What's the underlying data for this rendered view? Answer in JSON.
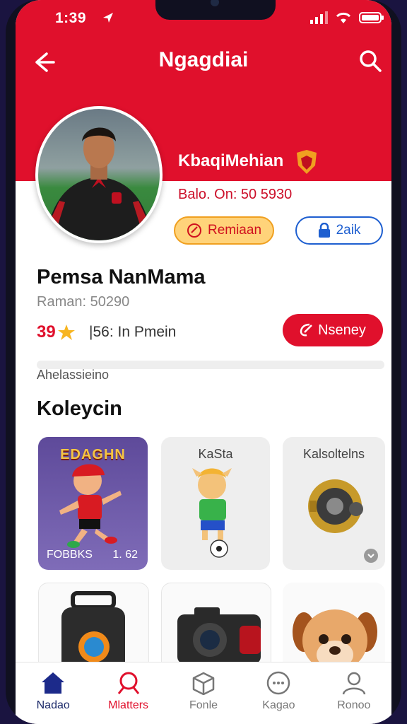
{
  "status_bar": {
    "time": "1:39"
  },
  "header": {
    "title": "Ngagdiai"
  },
  "profile": {
    "club_name": "KbaqiMehian",
    "balance": "Balo. On: 50 5930",
    "reward_button": "Remiaan",
    "lock_button": "2aik",
    "player_name": "Pemsa NanMama",
    "player_sub": "Raman: 50290",
    "score": "39",
    "rank_text": "|56: In Pmein",
    "money_button": "Nseney",
    "progress": 0.0,
    "progress_label": "Ahelassieino"
  },
  "collection": {
    "title": "Koleycin",
    "cards": [
      {
        "title": "EDAGHN",
        "foot_left": "FOBBKS",
        "foot_right": "1. 62"
      },
      {
        "title": "KaSta"
      },
      {
        "title": "Kalsoltelns"
      },
      {
        "title": ""
      },
      {
        "title": ""
      },
      {
        "title": ""
      }
    ]
  },
  "bottom_nav": [
    {
      "label": "Nadao",
      "icon": "home-icon"
    },
    {
      "label": "Mlatters",
      "icon": "whistle-icon"
    },
    {
      "label": "Fonle",
      "icon": "box-icon"
    },
    {
      "label": "Kagao",
      "icon": "chat-icon"
    },
    {
      "label": "Ronoo",
      "icon": "user-icon"
    }
  ],
  "colors": {
    "brand_red": "#e0102c",
    "accent_blue": "#1e5fd0",
    "reward_yellow": "#ffd37a"
  }
}
